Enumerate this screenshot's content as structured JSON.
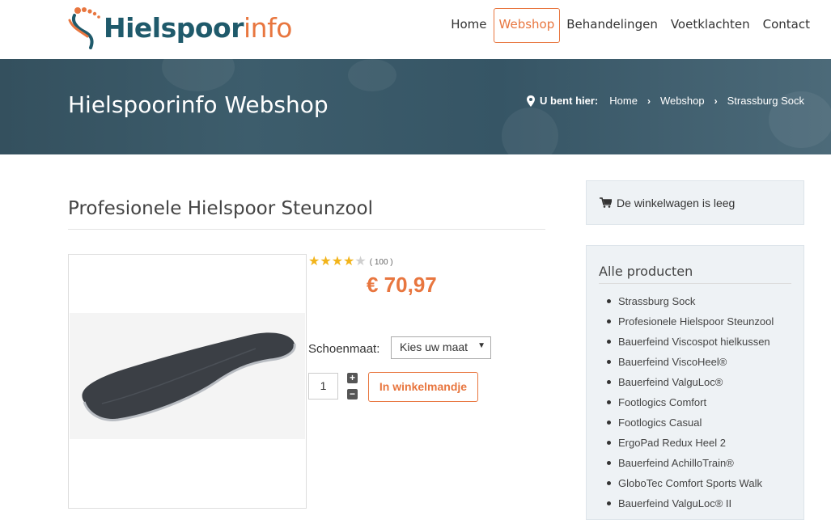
{
  "header": {
    "logo_part1": "Hielspoor",
    "logo_part2": "info",
    "nav": [
      {
        "label": "Home",
        "active": false
      },
      {
        "label": "Webshop",
        "active": true
      },
      {
        "label": "Behandelingen",
        "active": false
      },
      {
        "label": "Voetklachten",
        "active": false
      },
      {
        "label": "Contact",
        "active": false
      }
    ]
  },
  "banner": {
    "title": "Hielspoorinfo Webshop",
    "breadcrumb_label": "U bent hier:",
    "breadcrumb": [
      "Home",
      "Webshop",
      "Strassburg Sock"
    ]
  },
  "product": {
    "title": "Profesionele Hielspoor Steunzool",
    "rating_stars": 4,
    "rating_max": 5,
    "rating_count": "( 100 )",
    "price": "€ 70,97",
    "size_label": "Schoenmaat:",
    "size_select_value": "Kies uw maat",
    "quantity": "1",
    "add_to_cart": "In winkelmandje"
  },
  "sidebar": {
    "cart_text": "De winkelwagen is leeg",
    "products_heading": "Alle producten",
    "products": [
      "Strassburg Sock",
      "Profesionele Hielspoor Steunzool",
      "Bauerfeind Viscospot hielkussen",
      "Bauerfeind ViscoHeel®",
      "Bauerfeind ValguLoc®",
      "Footlogics Comfort",
      "Footlogics Casual",
      "ErgoPad Redux Heel 2",
      "Bauerfeind AchilloTrain®",
      "GloboTec Comfort Sports Walk",
      "Bauerfeind ValguLoc® II"
    ]
  },
  "colors": {
    "accent": "#e8763f",
    "brand_dark": "#1f5a6b",
    "banner": "#3d5d6c"
  }
}
